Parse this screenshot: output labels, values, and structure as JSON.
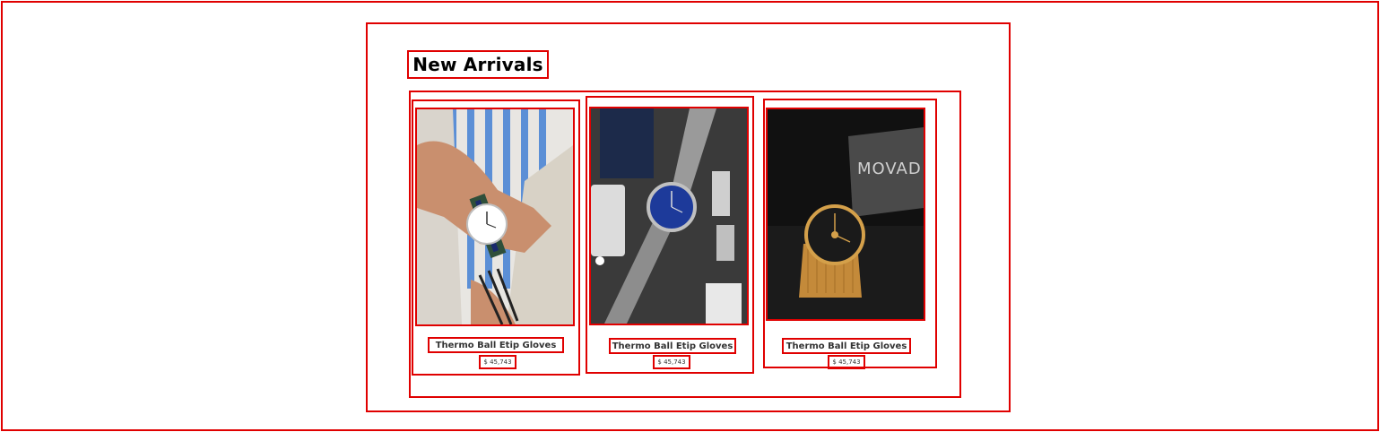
{
  "section": {
    "title": "New Arrivals"
  },
  "products": [
    {
      "name": "Thermo Ball Etip Gloves",
      "price": "$ 45,743",
      "image": "watch-on-wrist-image"
    },
    {
      "name": "Thermo Ball Etip Gloves",
      "price": "$ 45,743",
      "image": "blue-dial-mesh-watch-image"
    },
    {
      "name": "Thermo Ball Etip Gloves",
      "price": "$ 45,743",
      "image": "gold-movado-watch-image"
    }
  ],
  "colors": {
    "outline": "#e00000",
    "text": "#333333"
  }
}
